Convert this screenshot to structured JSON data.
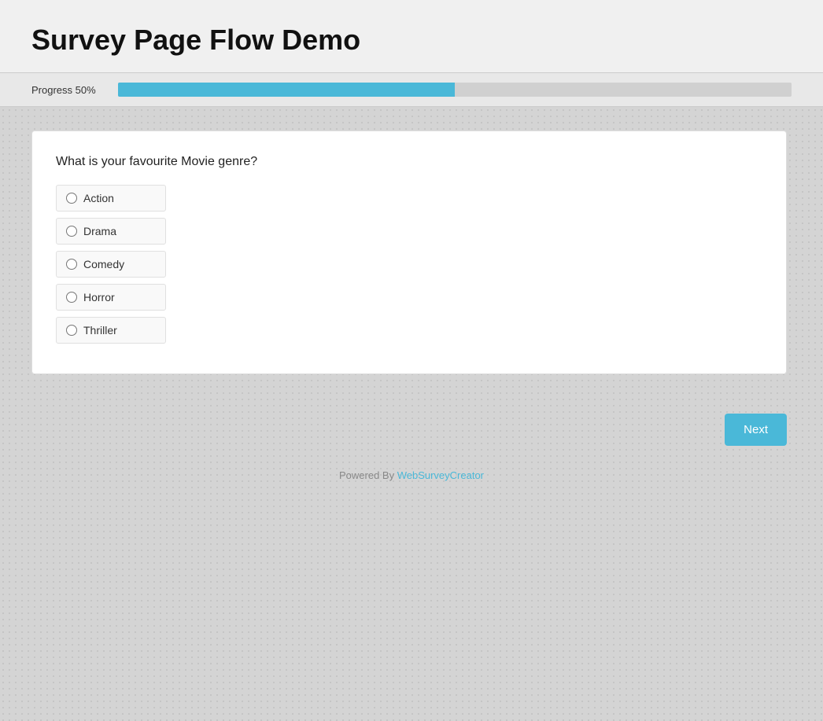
{
  "header": {
    "title": "Survey Page Flow Demo"
  },
  "progress": {
    "label": "Progress 50%",
    "percent": 50
  },
  "survey": {
    "question": "What is your favourite Movie genre?",
    "options": [
      {
        "id": "action",
        "label": "Action"
      },
      {
        "id": "drama",
        "label": "Drama"
      },
      {
        "id": "comedy",
        "label": "Comedy"
      },
      {
        "id": "horror",
        "label": "Horror"
      },
      {
        "id": "thriller",
        "label": "Thriller"
      }
    ]
  },
  "navigation": {
    "next_button": "Next"
  },
  "footer": {
    "powered_by_text": "Powered By",
    "powered_by_link": "WebSurveyCreator",
    "powered_by_url": "#"
  }
}
